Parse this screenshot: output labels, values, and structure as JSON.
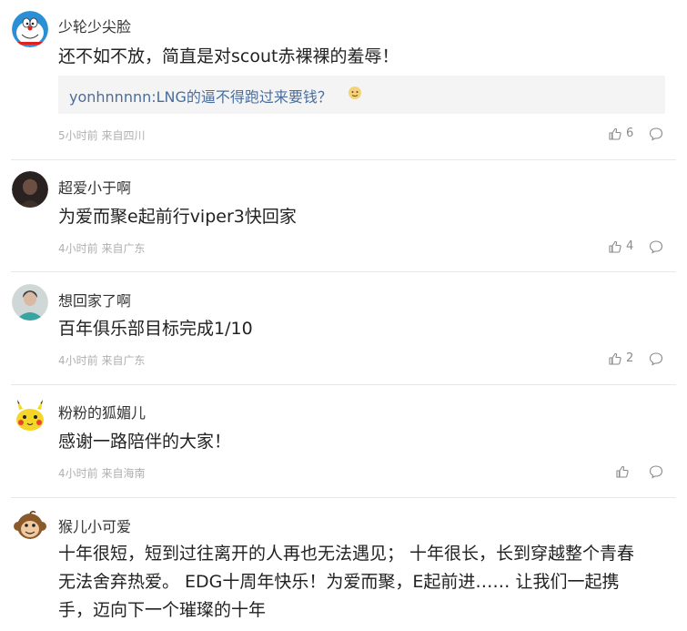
{
  "comments": [
    {
      "username": "少轮少尖脸",
      "text": "还不如不放，简直是对scout赤裸裸的羞辱！",
      "quote": "yonhnnnnn:LNG的逼不得跑过来要钱？",
      "meta": "5小时前 来自四川",
      "likes": "6",
      "avatar_icon": "doraemon-avatar-icon"
    },
    {
      "username": "超爱小于啊",
      "text": "为爱而聚e起前行viper3快回家",
      "meta": "4小时前 来自广东",
      "likes": "4",
      "avatar_icon": "dark-portrait-avatar-icon"
    },
    {
      "username": "想回家了啊",
      "text": "百年俱乐部目标完成1/10",
      "meta": "4小时前 来自广东",
      "likes": "2",
      "avatar_icon": "teal-portrait-avatar-icon"
    },
    {
      "username": "粉粉的狐媚儿",
      "text": "感谢一路陪伴的大家！",
      "meta": "4小时前 来自海南",
      "likes": "",
      "avatar_icon": "pikachu-avatar-icon"
    },
    {
      "username": "猴儿小可爱",
      "text_lines": [
        "十年很短，短到过往离开的人再也无法遇见； 十年很长，长到穿越整个青春",
        "无法舍弃热爱。 EDG十周年快乐！为爱而聚，E起前进…… 让我们一起携",
        "手，迈向下一个璀璨的十年"
      ],
      "avatar_icon": "monkey-avatar-icon"
    }
  ],
  "colors": {
    "username": "#333333",
    "text": "#222222",
    "quote_user": "#4a6d9c",
    "meta": "#b0b0b0",
    "divider": "#e8e8e8"
  },
  "icons": {
    "like": "thumbs-up-icon",
    "reply": "speech-bubble-icon"
  }
}
